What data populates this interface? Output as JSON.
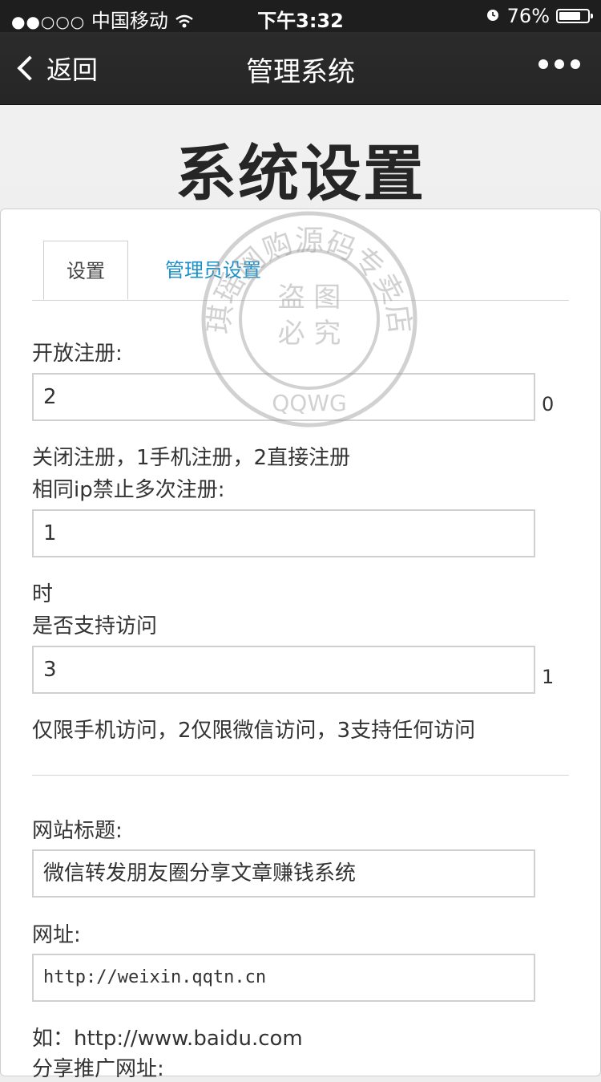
{
  "status_bar": {
    "carrier": "中国移动",
    "signal_dots": "●●○○○",
    "time": "下午3:32",
    "battery": "76%",
    "battery_level": 0.76
  },
  "nav": {
    "back_label": "返回",
    "title": "管理系统"
  },
  "page_title": "系统设置",
  "tabs": [
    {
      "label": "设置",
      "active": true
    },
    {
      "label": "管理员设置",
      "active": false
    }
  ],
  "form": {
    "open_register": {
      "label": "开放注册:",
      "value": "2",
      "suffix": "0",
      "hint": "关闭注册，1手机注册，2直接注册"
    },
    "same_ip": {
      "label": "相同ip禁止多次注册:",
      "value": "1",
      "hint": "时"
    },
    "access": {
      "label": "是否支持访问",
      "value": "3",
      "suffix": "1",
      "hint": "仅限手机访问，2仅限微信访问，3支持任何访问"
    },
    "site_title": {
      "label": "网站标题:",
      "value": "微信转发朋友圈分享文章赚钱系统"
    },
    "site_url": {
      "label": "网址:",
      "value": "http://weixin.qqtn.cn",
      "hint": "如：http://www.baidu.com"
    },
    "share_url": {
      "label": "分享推广网址:"
    }
  },
  "watermark": {
    "ring_text": "琪瑶网购源码专卖店",
    "center_line1": "盗 图",
    "center_line2": "必 究",
    "bottom": "QQWG"
  },
  "colors": {
    "link": "#1a8fc9",
    "navbar": "#262626"
  }
}
